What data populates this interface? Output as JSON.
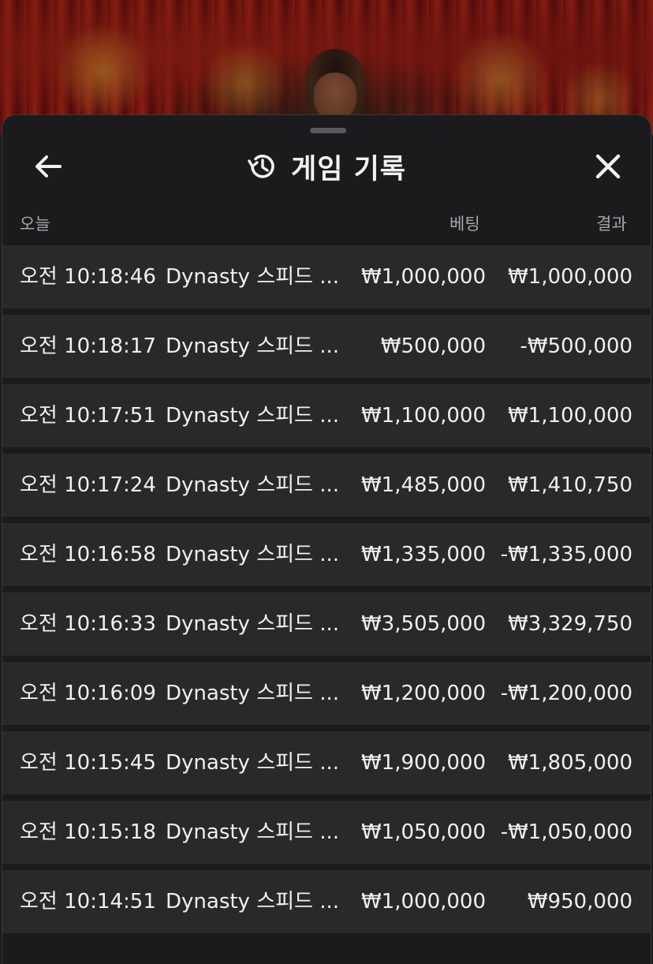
{
  "header": {
    "title": "게임 기록",
    "back_icon": "arrow-left-icon",
    "history_icon": "history-clock-icon",
    "close_icon": "close-icon"
  },
  "columns": {
    "date": "오늘",
    "bet": "베팅",
    "result": "결과"
  },
  "rows": [
    {
      "time": "오전 10:18:46",
      "game": "Dynasty 스피드 ...",
      "bet": "₩1,000,000",
      "result": "₩1,000,000"
    },
    {
      "time": "오전 10:18:17",
      "game": "Dynasty 스피드 ...",
      "bet": "₩500,000",
      "result": "-₩500,000"
    },
    {
      "time": "오전 10:17:51",
      "game": "Dynasty 스피드 ...",
      "bet": "₩1,100,000",
      "result": "₩1,100,000"
    },
    {
      "time": "오전 10:17:24",
      "game": "Dynasty 스피드 ...",
      "bet": "₩1,485,000",
      "result": "₩1,410,750"
    },
    {
      "time": "오전 10:16:58",
      "game": "Dynasty 스피드 ...",
      "bet": "₩1,335,000",
      "result": "-₩1,335,000"
    },
    {
      "time": "오전 10:16:33",
      "game": "Dynasty 스피드 ...",
      "bet": "₩3,505,000",
      "result": "₩3,329,750"
    },
    {
      "time": "오전 10:16:09",
      "game": "Dynasty 스피드 ...",
      "bet": "₩1,200,000",
      "result": "-₩1,200,000"
    },
    {
      "time": "오전 10:15:45",
      "game": "Dynasty 스피드 ...",
      "bet": "₩1,900,000",
      "result": "₩1,805,000"
    },
    {
      "time": "오전 10:15:18",
      "game": "Dynasty 스피드 ...",
      "bet": "₩1,050,000",
      "result": "-₩1,050,000"
    },
    {
      "time": "오전 10:14:51",
      "game": "Dynasty 스피드 ...",
      "bet": "₩1,000,000",
      "result": "₩950,000"
    }
  ],
  "colors": {
    "panel_bg": "#1b1b1d",
    "row_bg": "#29292c",
    "text": "#f0f0f0",
    "muted": "#a6a6aa"
  }
}
